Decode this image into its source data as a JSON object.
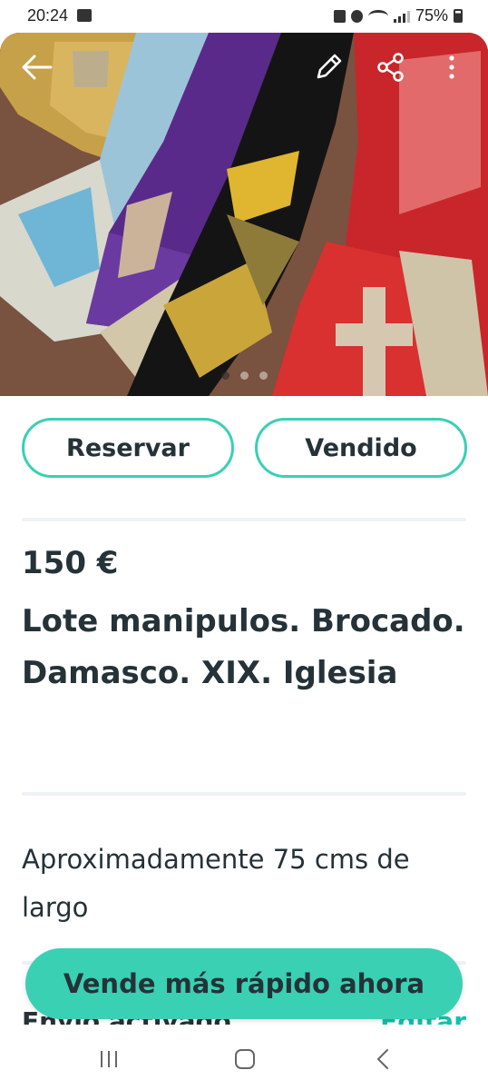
{
  "status_bar": {
    "time": "20:24",
    "battery": "75%",
    "icons": [
      "image-icon",
      "lock-icon",
      "alarm-icon",
      "wifi-icon",
      "signal-icon",
      "battery-icon"
    ]
  },
  "image_gallery": {
    "slide_count": 3,
    "active_slide": 1,
    "icons": [
      "back-arrow-icon",
      "edit-pencil-icon",
      "share-icon",
      "more-vertical-icon"
    ]
  },
  "actions": {
    "reserve_label": "Reservar",
    "sold_label": "Vendido"
  },
  "item": {
    "price": "150 €",
    "title": "Lote manipulos. Brocado. Damasco. XIX. Iglesia",
    "description": "Aproximadamente 75 cms de largo"
  },
  "shipping": {
    "label": "Envío activado",
    "edit_label": "Editar"
  },
  "cta": {
    "label": "Vende más rápido ahora"
  },
  "colors": {
    "accent": "#3ad0b4",
    "text": "#253238",
    "link": "#13c1ac"
  },
  "nav": {
    "icons": [
      "recent-apps-icon",
      "home-icon",
      "back-icon"
    ]
  }
}
